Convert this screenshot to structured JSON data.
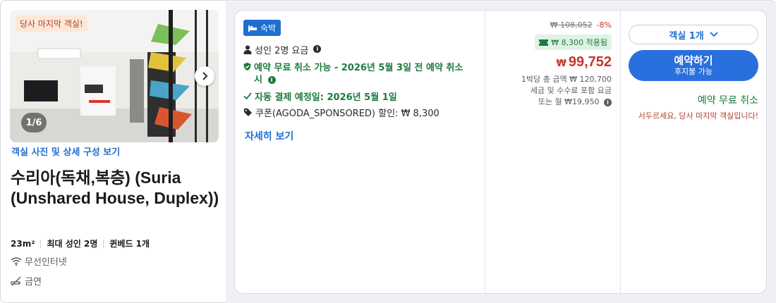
{
  "room": {
    "badge": "당사 마지막 객실!",
    "photo_counter": "1/6",
    "photo_link": "객실 사진 및 상세 구성 보기",
    "title": "수리아(독채,복층) (Suria (Unshared House, Duplex))",
    "specs": [
      "23m²",
      "최대 성인 2명",
      "퀸베드 1개"
    ],
    "amenities": [
      {
        "icon": "wifi-icon",
        "label": "무선인터넷"
      },
      {
        "icon": "no-smoking-icon",
        "label": "금연"
      }
    ]
  },
  "offer": {
    "tag": "숙박",
    "occupancy": "성인 2명 요금",
    "cancellation": "예약 무료 취소 가능 - 2026년 5월 3일 전 예약 취소 시",
    "autopay": "자동 결제 예정일: 2026년 5월 1일",
    "coupon": "쿠폰(AGODA_SPONSORED) 할인: ₩ 8,300",
    "more_link": "자세히 보기"
  },
  "price": {
    "original": "₩ 108,052",
    "discount_pct": "-8%",
    "coupon_applied": "₩ 8,300 적용됨",
    "currency": "₩",
    "final": "99,752",
    "note_line1": "1박당 총 금액 ₩ 120,700",
    "note_line2": "세금 및 수수료 포함 요금",
    "note_line3": "또는 월 ₩19,950"
  },
  "booking": {
    "room_select": "객실 1개",
    "book_label": "예약하기",
    "book_sub": "후지불 가능",
    "free_cancel": "예약 무료 취소",
    "hurry": "서두르세요, 당사 마지막 객실입니다!"
  },
  "colors": {
    "brand_blue": "#2a6fde",
    "green": "#1d7a3d",
    "red": "#c4352b"
  }
}
